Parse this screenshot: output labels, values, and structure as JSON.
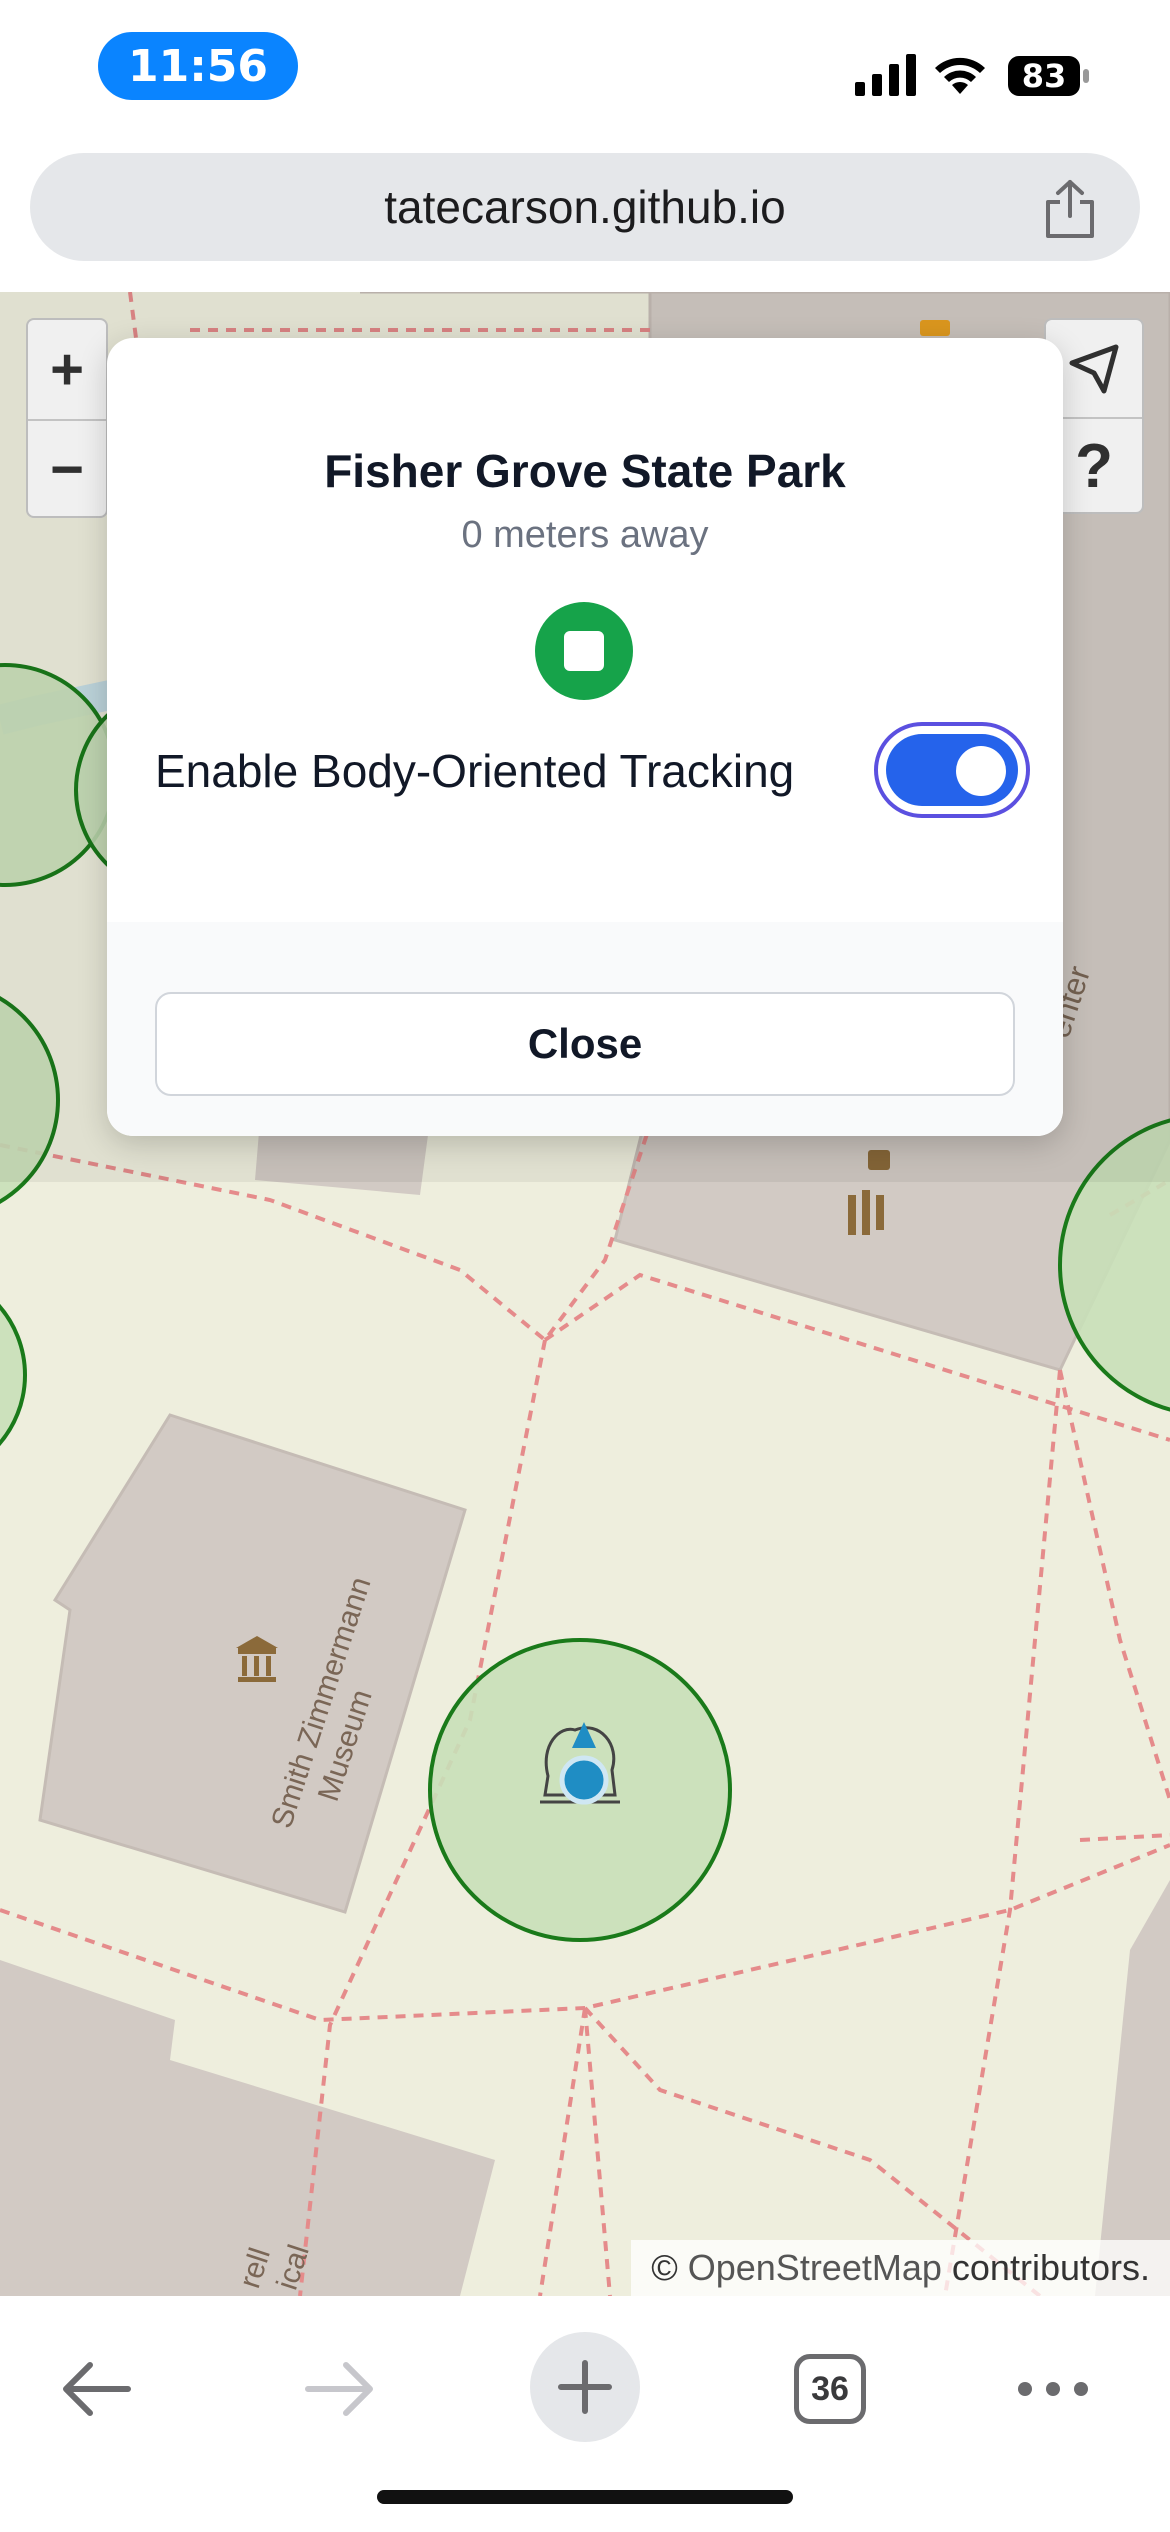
{
  "status_bar": {
    "time": "11:56",
    "battery_level": "83"
  },
  "url_bar": {
    "domain": "tatecarson.github.io"
  },
  "map": {
    "attribution_prefix": "©",
    "attribution_link": "OpenStreetMap",
    "attribution_suffix": "contributors.",
    "zoom_in": "+",
    "zoom_out": "−",
    "help": "?",
    "label_museum_1": "Smith Zimmermann",
    "label_museum_2": "Museum",
    "label_center": "enter",
    "label_bottom_1": "rell",
    "label_bottom_2": "ical"
  },
  "modal": {
    "title": "Fisher Grove State Park",
    "distance": "0 meters away",
    "toggle_label": "Enable Body-Oriented Tracking",
    "toggle_on": true,
    "close_label": "Close"
  },
  "toolbar": {
    "tab_count": "36"
  },
  "colors": {
    "accent_blue": "#2563eb",
    "stop_green": "#16a34a",
    "circle_stroke": "#1a7a1a",
    "circle_fill": "#c8dfb8",
    "building": "#d2cac4",
    "map_bg": "#eeeedd"
  }
}
